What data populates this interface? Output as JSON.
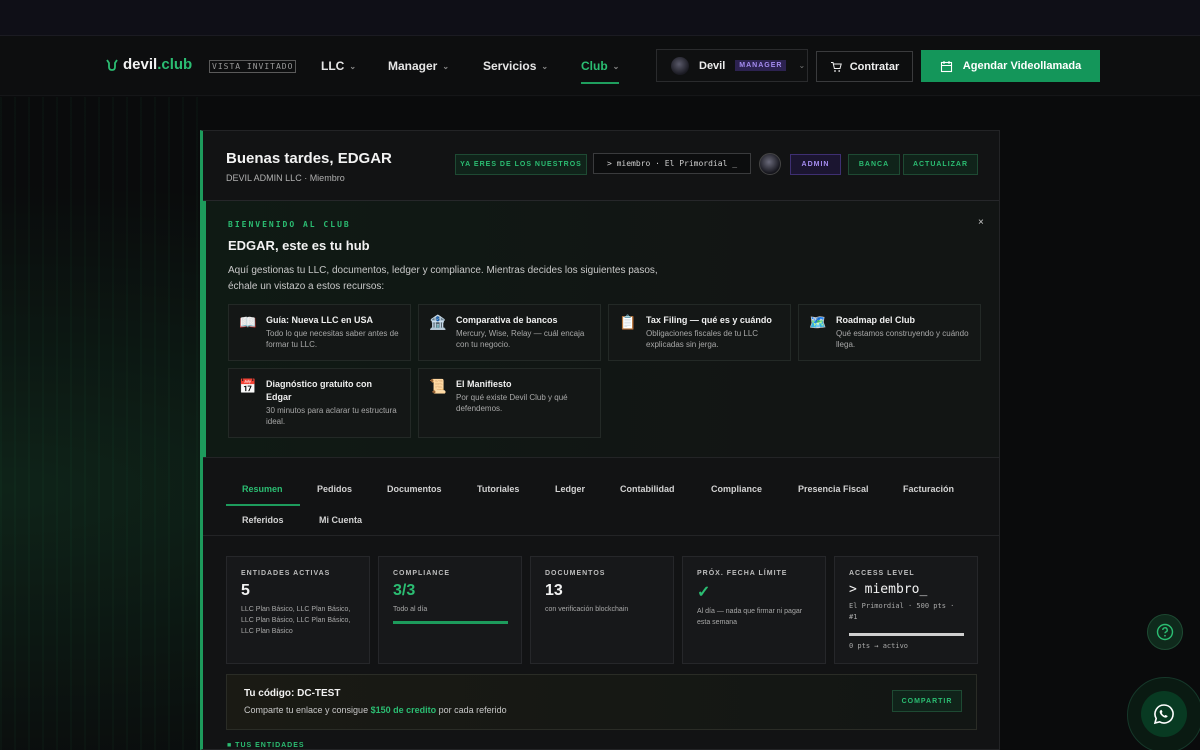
{
  "brand": {
    "name_main": "devil",
    "name_suffix": ".club",
    "guest_view": "VISTA INVITADO"
  },
  "nav": {
    "links": [
      {
        "label": "LLC"
      },
      {
        "label": "Manager"
      },
      {
        "label": "Servicios"
      },
      {
        "label": "Club",
        "active": true
      }
    ],
    "user": {
      "name": "Devil",
      "role_badge": "MANAGER"
    },
    "contratar": "Contratar",
    "agendar": "Agendar Videollamada"
  },
  "header": {
    "greeting": "Buenas tardes, EDGAR",
    "subtitle": "DEVIL ADMIN LLC · Miembro",
    "chip_member": "YA ERES DE LOS NUESTROS",
    "terminal": "> miembro · El Primordial _",
    "chip_admin": "ADMIN",
    "chip_banca": "BANCA",
    "chip_actualizar": "ACTUALIZAR"
  },
  "welcome": {
    "kicker": "BIENVENIDO AL CLUB",
    "title": "EDGAR, este es tu hub",
    "desc_line1": "Aquí gestionas tu LLC, documentos, ledger y compliance. Mientras decides los siguientes pasos,",
    "desc_line2": "échale un vistazo a estos recursos:",
    "close": "×",
    "cards": [
      {
        "icon": "📖",
        "title": "Guía: Nueva LLC en USA",
        "desc": "Todo lo que necesitas saber antes de formar tu LLC."
      },
      {
        "icon": "🏦",
        "title": "Comparativa de bancos",
        "desc": "Mercury, Wise, Relay — cuál encaja con tu negocio."
      },
      {
        "icon": "📋",
        "title": "Tax Filing — qué es y cuándo",
        "desc": "Obligaciones fiscales de tu LLC explicadas sin jerga."
      },
      {
        "icon": "🗺️",
        "title": "Roadmap del Club",
        "desc": "Qué estamos construyendo y cuándo llega."
      },
      {
        "icon": "📅",
        "title": "Diagnóstico gratuito con Edgar",
        "desc": "30 minutos para aclarar tu estructura ideal."
      },
      {
        "icon": "📜",
        "title": "El Manifiesto",
        "desc": "Por qué existe Devil Club y qué defendemos."
      }
    ]
  },
  "tabs": [
    "Resumen",
    "Pedidos",
    "Documentos",
    "Tutoriales",
    "Ledger",
    "Contabilidad",
    "Compliance",
    "Presencia Fiscal",
    "Facturación",
    "Referidos",
    "Mi Cuenta"
  ],
  "stats": [
    {
      "label": "ENTIDADES ACTIVAS",
      "value": "5",
      "sub": "LLC Plan Básico, LLC Plan Básico, LLC Plan Básico, LLC Plan Básico, LLC Plan Básico"
    },
    {
      "label": "COMPLIANCE",
      "value": "3/3",
      "sub": "Todo al día",
      "progress": 1.0
    },
    {
      "label": "DOCUMENTOS",
      "value": "13",
      "sub": "con verificación blockchain"
    },
    {
      "label": "PRÓX. FECHA LÍMITE",
      "value": "✓",
      "sub": "Al día — nada que firmar ni pagar esta semana"
    },
    {
      "label": "ACCESS LEVEL",
      "value": "> miembro_",
      "sub": "El Primordial · 500 pts · #1",
      "progress": 1.0,
      "foot": "0 pts → activo"
    }
  ],
  "referral": {
    "code": "Tu código: DC-TEST",
    "desc_pre": "Comparte tu enlace y consigue ",
    "desc_amount": "$150 de credito",
    "desc_post": " por cada referido",
    "button": "COMPARTIR"
  },
  "section_entities": "■ TUS ENTIDADES",
  "colors": {
    "accent": "#2bbd72",
    "accent_dark": "#14965a",
    "purple": "#a58cf0",
    "background": "#0b0c0d"
  }
}
